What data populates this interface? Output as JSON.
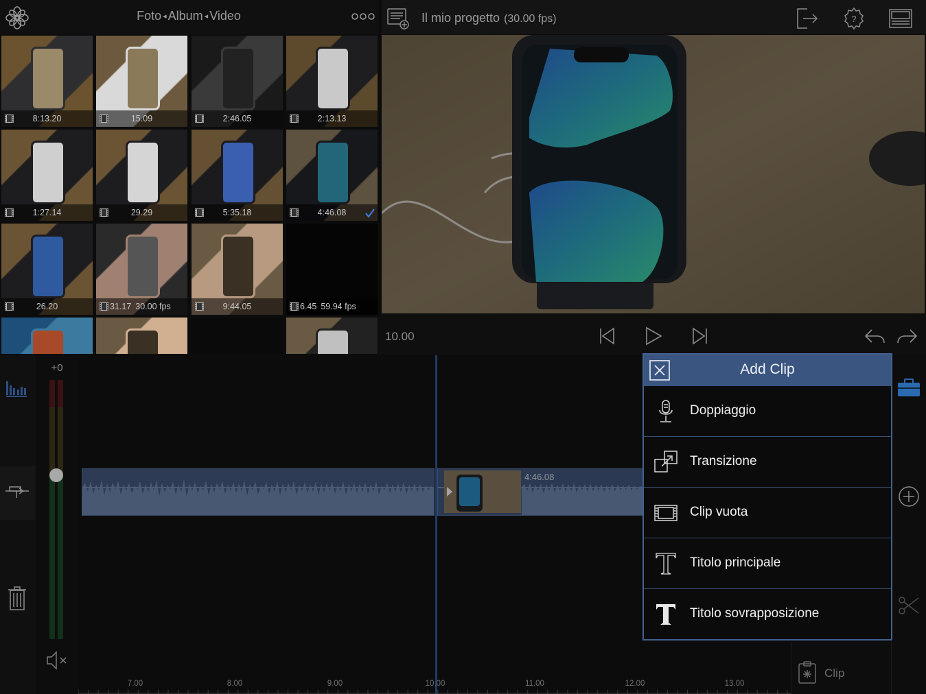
{
  "library": {
    "tabs": [
      "Foto",
      "Album",
      "Video"
    ],
    "logo_icon": "flower-logo-icon",
    "more_icon": "more-dots-icon",
    "thumbnails": [
      {
        "duration": "8:13.20",
        "fps": "",
        "kind": "video",
        "selected": false
      },
      {
        "duration": "15.09",
        "fps": "",
        "kind": "video",
        "selected": false
      },
      {
        "duration": "2:46.05",
        "fps": "",
        "kind": "video",
        "selected": false
      },
      {
        "duration": "2:13.13",
        "fps": "",
        "kind": "video",
        "selected": false
      },
      {
        "duration": "1:27.14",
        "fps": "",
        "kind": "video",
        "selected": false
      },
      {
        "duration": "29.29",
        "fps": "",
        "kind": "video",
        "selected": false
      },
      {
        "duration": "5:35.18",
        "fps": "",
        "kind": "video",
        "selected": false
      },
      {
        "duration": "4:46.08",
        "fps": "",
        "kind": "video",
        "selected": true
      },
      {
        "duration": "26.20",
        "fps": "",
        "kind": "video",
        "selected": false
      },
      {
        "duration": "31.17",
        "fps": "30.00 fps",
        "kind": "video",
        "selected": false
      },
      {
        "duration": "9:44.05",
        "fps": "",
        "kind": "video",
        "selected": false
      },
      {
        "duration": "6.45",
        "fps": "59.94 fps",
        "kind": "video",
        "selected": false
      },
      {
        "duration": "",
        "fps": "",
        "kind": "video",
        "selected": false
      },
      {
        "duration": "",
        "fps": "",
        "kind": "video",
        "selected": false
      },
      {
        "duration": "",
        "fps": "",
        "kind": "video",
        "selected": false
      },
      {
        "duration": "",
        "fps": "",
        "kind": "video",
        "selected": false
      }
    ]
  },
  "project": {
    "title": "Il mio progetto",
    "fps": "(30.00 fps)",
    "icons": [
      "project-list-icon",
      "export-icon",
      "settings-help-icon",
      "layout-icon"
    ]
  },
  "transport": {
    "timecode": "10.00",
    "icons": [
      "skip-back-icon",
      "play-icon",
      "skip-forward-icon",
      "undo-icon",
      "redo-icon"
    ]
  },
  "meter": {
    "label": "+0",
    "level": 0.0
  },
  "timeline": {
    "clip_label": "4:46.08",
    "ruler": [
      "7.00",
      "8.00",
      "9.00",
      "10.00",
      "11.00",
      "12.00",
      "13.00"
    ]
  },
  "popup": {
    "title": "Add Clip",
    "items": [
      {
        "label": "Doppiaggio",
        "icon": "microphone-icon"
      },
      {
        "label": "Transizione",
        "icon": "transition-icon"
      },
      {
        "label": "Clip vuota",
        "icon": "empty-clip-icon"
      },
      {
        "label": "Titolo principale",
        "icon": "title-outline-icon"
      },
      {
        "label": "Titolo sovrapposizione",
        "icon": "title-bold-icon"
      }
    ]
  },
  "clip_box": {
    "label": "Clip"
  },
  "colors": {
    "accent": "#3a5580",
    "popup_border": "#43618f",
    "track": "#2d3c54",
    "toolbox": "#2a6ab0"
  }
}
